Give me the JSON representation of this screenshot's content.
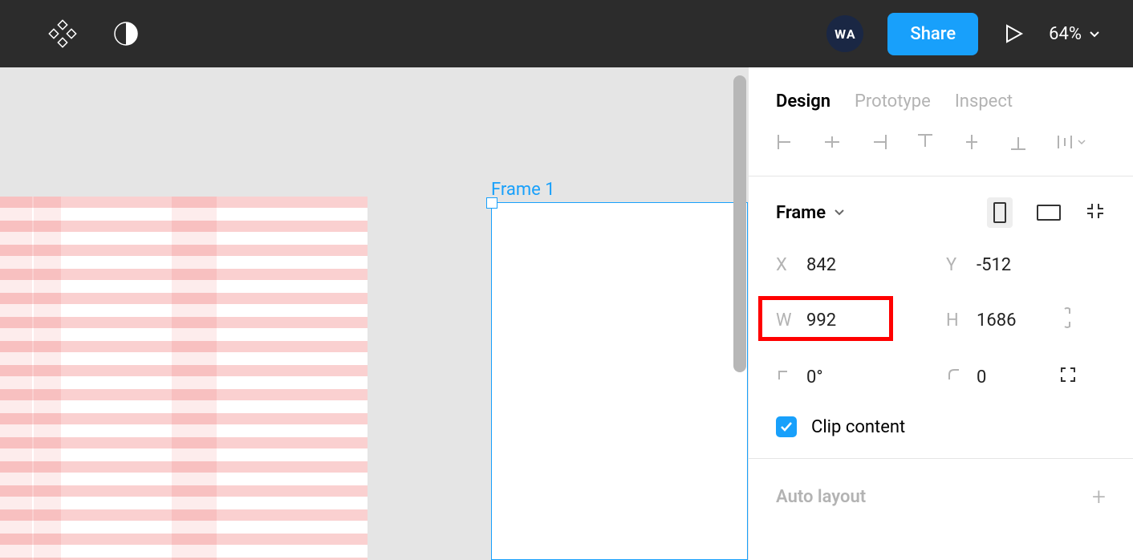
{
  "topbar": {
    "avatar_text": "WA",
    "share_label": "Share",
    "zoom_label": "64%"
  },
  "canvas": {
    "frame_label": "Frame 1"
  },
  "panel": {
    "tabs": {
      "design": "Design",
      "prototype": "Prototype",
      "inspect": "Inspect"
    },
    "frame_title": "Frame",
    "fields": {
      "x_label": "X",
      "x_value": "842",
      "y_label": "Y",
      "y_value": "-512",
      "w_label": "W",
      "w_value": "992",
      "h_label": "H",
      "h_value": "1686",
      "r_label": "",
      "r_value": "0°",
      "c_label": "",
      "c_value": "0"
    },
    "clip_label": "Clip content",
    "autolayout_label": "Auto layout"
  }
}
